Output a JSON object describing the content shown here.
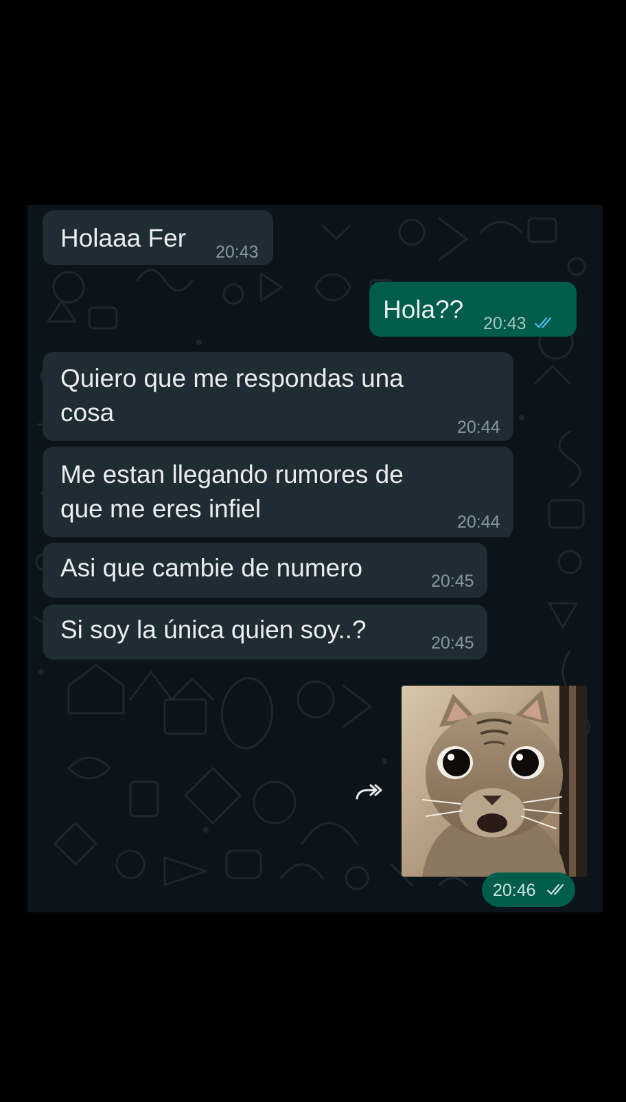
{
  "messages": [
    {
      "direction": "in",
      "text": "Holaaa Fer",
      "time": "20:43"
    },
    {
      "direction": "out",
      "text": "Hola??",
      "time": "20:43",
      "status": "read"
    },
    {
      "direction": "in",
      "text": "Quiero que me respondas una\ncosa",
      "time": "20:44"
    },
    {
      "direction": "in",
      "text": "Me estan llegando rumores de\nque me eres infiel",
      "time": "20:44"
    },
    {
      "direction": "in",
      "text": "Asi que cambie de numero",
      "time": "20:45"
    },
    {
      "direction": "in",
      "text": "Si soy la única quien soy..?",
      "time": "20:45"
    },
    {
      "direction": "out",
      "type": "image",
      "image": "shocked-cat-photo",
      "time": "20:46",
      "status": "read"
    }
  ],
  "icons": {
    "forward": "forward-icon",
    "read_receipt": "double-check-icon"
  },
  "colors": {
    "background": "#0b141a",
    "incoming_bubble": "#1f2c34",
    "outgoing_bubble": "#005c4b",
    "text": "#e9edef",
    "time_text": "#8696a0",
    "read_tick": "#53bdeb"
  }
}
